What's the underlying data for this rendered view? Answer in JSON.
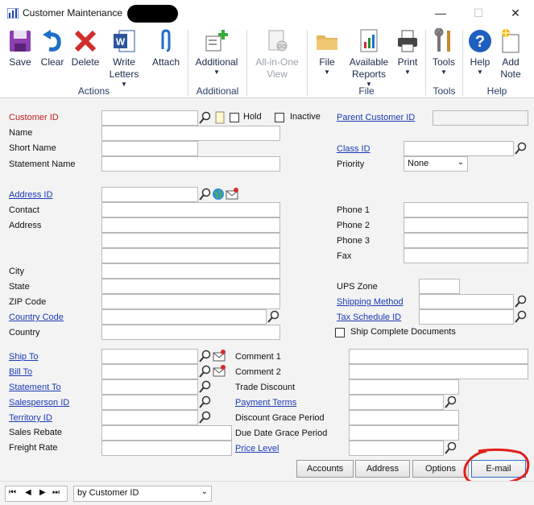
{
  "window": {
    "title": "Customer Maintenance",
    "minimize": "—",
    "maximize": "☐",
    "close": "✕"
  },
  "ribbon": {
    "actions": {
      "save": "Save",
      "clear": "Clear",
      "delete": "Delete",
      "write_letters": "Write Letters",
      "attach": "Attach",
      "group": "Actions"
    },
    "additional": {
      "additional": "Additional",
      "group": "Additional"
    },
    "view": {
      "all_in_one": "All-in-One View"
    },
    "file": {
      "file": "File",
      "available_reports": "Available Reports",
      "print": "Print",
      "group": "File"
    },
    "tools": {
      "tools": "Tools",
      "group": "Tools"
    },
    "help": {
      "help": "Help",
      "add_note": "Add Note",
      "group": "Help"
    }
  },
  "form": {
    "customer_id": "Customer ID",
    "hold": "Hold",
    "inactive": "Inactive",
    "parent_customer_id": "Parent Customer ID",
    "name": "Name",
    "short_name": "Short Name",
    "statement_name": "Statement Name",
    "class_id": "Class ID",
    "priority": "Priority",
    "priority_value": "None",
    "address_id": "Address ID",
    "contact": "Contact",
    "address": "Address",
    "city": "City",
    "state": "State",
    "zip_code": "ZIP Code",
    "country_code": "Country Code",
    "country": "Country",
    "phone1": "Phone 1",
    "phone2": "Phone 2",
    "phone3": "Phone 3",
    "fax": "Fax",
    "ups_zone": "UPS Zone",
    "shipping_method": "Shipping Method",
    "tax_schedule_id": "Tax Schedule ID",
    "ship_complete": "Ship Complete Documents",
    "ship_to": "Ship To",
    "bill_to": "Bill To",
    "statement_to": "Statement To",
    "salesperson_id": "Salesperson ID",
    "territory_id": "Territory ID",
    "sales_rebate": "Sales Rebate",
    "freight_rate": "Freight Rate",
    "comment1": "Comment 1",
    "comment2": "Comment 2",
    "trade_discount": "Trade Discount",
    "payment_terms": "Payment Terms",
    "discount_grace_period": "Discount Grace Period",
    "due_date_grace_period": "Due Date Grace Period",
    "price_level": "Price Level"
  },
  "buttons": {
    "accounts": "Accounts",
    "address": "Address",
    "options": "Options",
    "email": "E-mail"
  },
  "nav": {
    "sort": "by Customer ID",
    "first": "⏮",
    "prev": "◀",
    "next": "▶",
    "last": "⏭"
  },
  "colors": {
    "required": "#c02020",
    "link": "#1a3bb5",
    "annotation": "#e0201c"
  }
}
